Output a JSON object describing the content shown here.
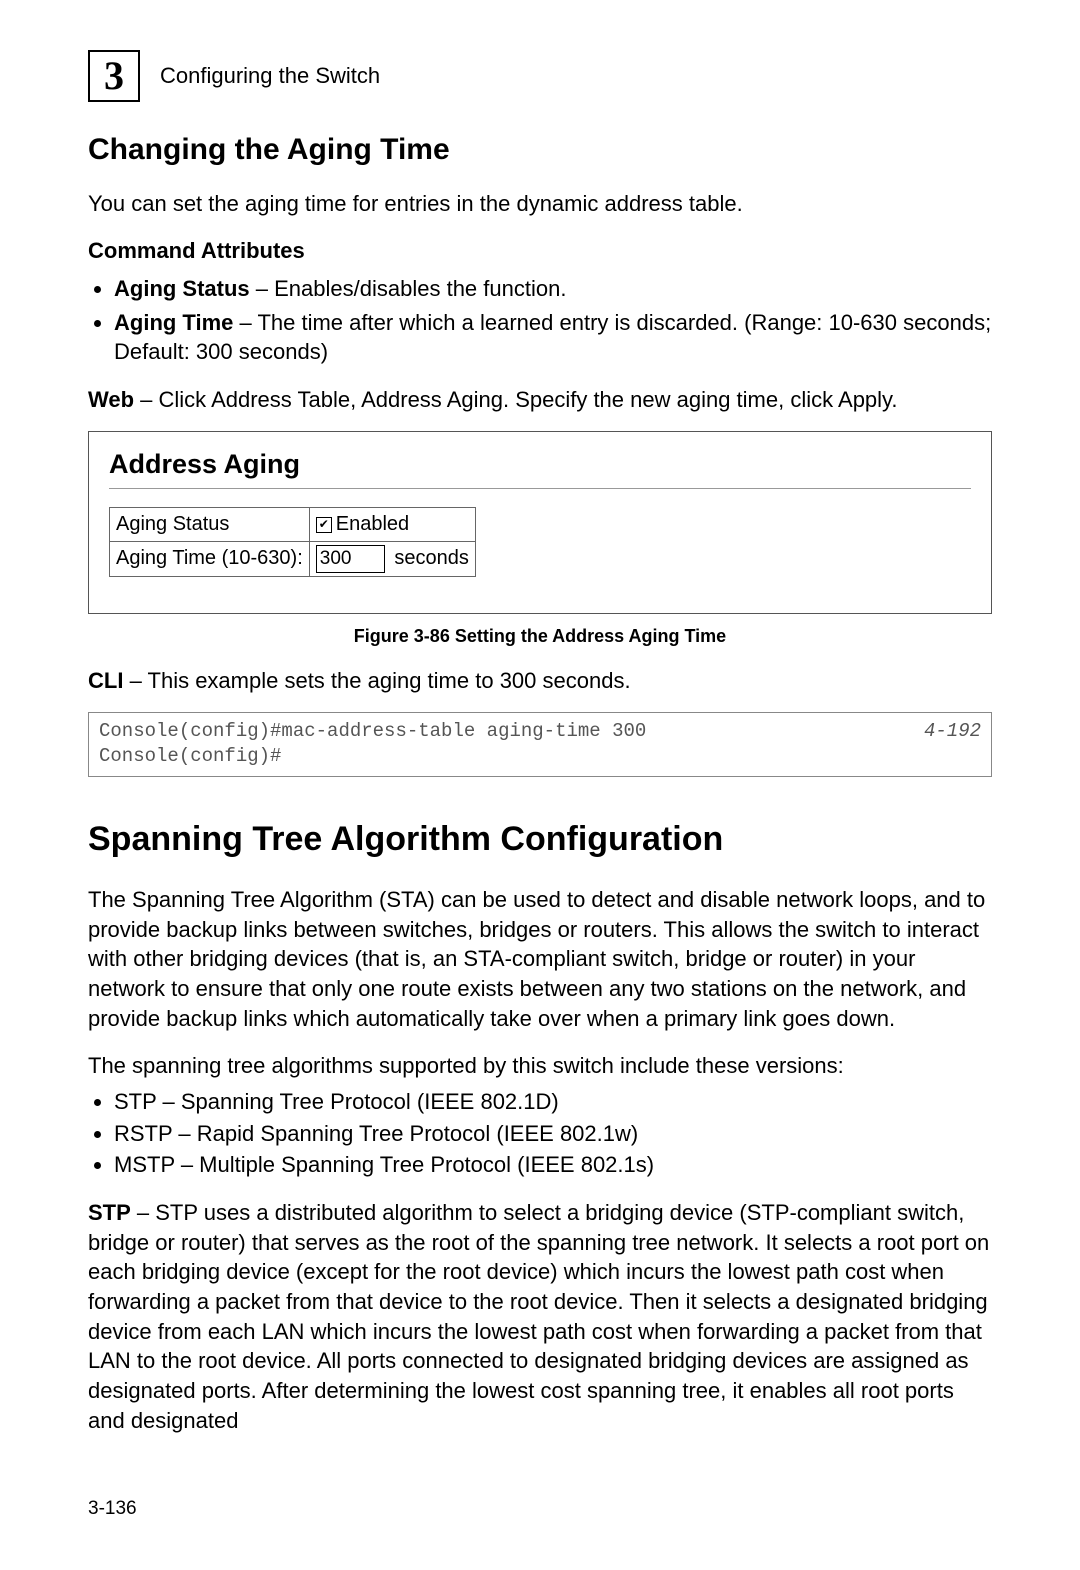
{
  "header": {
    "chapter_num": "3",
    "label": "Configuring the Switch"
  },
  "section1": {
    "title": "Changing the Aging Time",
    "intro": "You can set the aging time for entries in the dynamic address table.",
    "cmd_attr_head": "Command Attributes",
    "attr1_bold": "Aging Status",
    "attr1_rest": " – Enables/disables the function.",
    "attr2_bold": "Aging Time",
    "attr2_rest": " – The time after which a learned entry is discarded. (Range: 10-630 seconds; Default: 300 seconds)",
    "web_bold": "Web",
    "web_rest": " – Click Address Table, Address Aging. Specify the new aging time, click Apply.",
    "panel": {
      "title": "Address Aging",
      "row1_label": "Aging Status",
      "row1_value": "Enabled",
      "row2_label": "Aging Time (10-630):",
      "row2_value": "300",
      "row2_unit": " seconds"
    },
    "figure_caption": "Figure 3-86  Setting the Address Aging Time",
    "cli_bold": "CLI",
    "cli_rest": " – This example sets the aging time to 300 seconds.",
    "code_lines": "Console(config)#mac-address-table aging-time 300\nConsole(config)#",
    "code_ref": "4-192"
  },
  "section2": {
    "title": "Spanning Tree Algorithm Configuration",
    "para1": "The Spanning Tree Algorithm (STA) can be used to detect and disable network loops, and to provide backup links between switches, bridges or routers. This allows the switch to interact with other bridging devices (that is, an STA-compliant switch, bridge or router) in your network to ensure that only one route exists between any two stations on the network, and provide backup links which automatically take over when a primary link goes down.",
    "para2": "The spanning tree algorithms supported by this switch include these versions:",
    "ver1": "STP – Spanning Tree Protocol (IEEE 802.1D)",
    "ver2": "RSTP – Rapid Spanning Tree Protocol (IEEE 802.1w)",
    "ver3": "MSTP – Multiple Spanning Tree Protocol (IEEE 802.1s)",
    "stp_bold": "STP",
    "stp_rest": " – STP uses a distributed algorithm to select a bridging device (STP-compliant switch, bridge or router) that serves as the root of the spanning tree network. It selects a root port on each bridging device (except for the root device) which incurs the lowest path cost when forwarding a packet from that device to the root device. Then it selects a designated bridging device from each LAN which incurs the lowest path cost when forwarding a packet from that LAN to the root device. All ports connected to designated bridging devices are assigned as designated ports. After determining the lowest cost spanning tree, it enables all root ports and designated"
  },
  "page_number": "3-136"
}
